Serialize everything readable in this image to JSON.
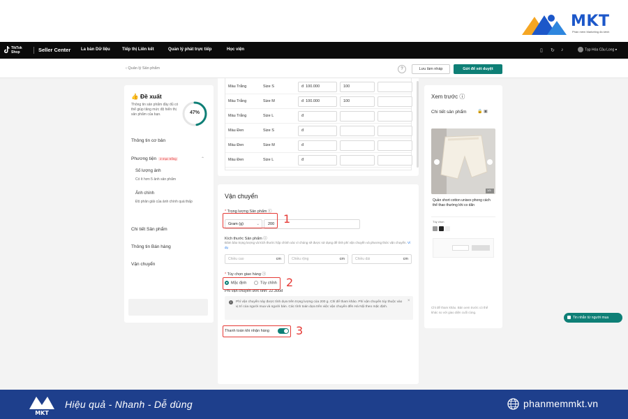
{
  "brand": {
    "name": "MKT",
    "subtitle": "Phần mềm Marketing đa kênh",
    "accent": "#1c57c9"
  },
  "topnav": {
    "logo_text": [
      "TikTok",
      "Shop"
    ],
    "title": "Seller Center",
    "links": [
      "La bàn Dữ liệu",
      "Tiếp thị Liên kết",
      "Quản lý phát trực tiếp",
      "Học viện"
    ],
    "user_name": "Tạp Hóa Cầu Long"
  },
  "subbar": {
    "breadcrumb": "‹ Quản lý Sản phẩm",
    "help_icon": "?",
    "save_draft": "Lưu làm nháp",
    "submit": "Gửi để xét duyệt",
    "accent": "#0e7f76"
  },
  "left_panel": {
    "title": "Đề xuất",
    "description": "Thông tin sản phẩm đầy đủ có thể giúp tăng mức độ hiển thị sản phẩm của bạn.",
    "progress_label": "47%",
    "progress_value": 47,
    "items": {
      "basic": "Thông tin cơ bản",
      "media": "Phương tiện",
      "media_badge": "2 mục trống",
      "image_count": "Số lượng ảnh",
      "image_count_desc": "Có ít hơn 5 ảnh sản phẩm",
      "main_image": "Ảnh chính",
      "main_image_desc": "Độ phân giải của ảnh chính quá thấp",
      "details": "Chi tiết Sản phẩm",
      "sales": "Thông tin Bán hàng",
      "shipping": "Vận chuyển"
    }
  },
  "variants": {
    "rows": [
      {
        "color": "Màu Trắng",
        "size": "Size S",
        "price": "100.000",
        "qty": "100"
      },
      {
        "color": "Màu Trắng",
        "size": "Size M",
        "price": "100.000",
        "qty": "100"
      },
      {
        "color": "Màu Trắng",
        "size": "Size L",
        "price": "",
        "qty": ""
      },
      {
        "color": "Màu Đen",
        "size": "Size S",
        "price": "",
        "qty": ""
      },
      {
        "color": "Màu Đen",
        "size": "Size M",
        "price": "",
        "qty": ""
      },
      {
        "color": "Màu Đen",
        "size": "Size L",
        "price": "",
        "qty": ""
      }
    ],
    "currency": "đ"
  },
  "shipping": {
    "title": "Vận chuyển",
    "weight_label": "Trọng lượng Sản phẩm",
    "weight_unit": "Gram (g)",
    "weight_value": "200",
    "dims_label": "Kích thước Sản phẩm",
    "dims_desc": "Đảm bảo trọng lượng và kích thước hộp chính xác vì chúng sẽ được sử dụng để tính phí vận chuyển và phương thức vận chuyển.",
    "dims_link": "Ví dụ",
    "dims": [
      {
        "placeholder": "Chiều cao",
        "unit": "cm"
      },
      {
        "placeholder": "Chiều rộng",
        "unit": "cm"
      },
      {
        "placeholder": "Chiều dài",
        "unit": "cm"
      }
    ],
    "options_label": "Tùy chọn giao hàng",
    "option_default": "Mặc định",
    "option_custom": "Tùy chỉnh",
    "fee": "Phí vận chuyển ước tính: 22.300đ",
    "info": "Phí vận chuyển này được tính dựa trên trọng lượng của 200 g. Chỉ để tham khảo. Phí vận chuyển tùy thuộc vào vị trí của người mua và người bán. Các tính toán dựa trên việc vận chuyển đến Hà Nội theo mặc định.",
    "cod_label": "Thanh toán khi nhận hàng",
    "cod_on": true
  },
  "annotations": [
    "1",
    "2",
    "3"
  ],
  "preview": {
    "title": "Xem trước",
    "subtitle": "Chi tiết sản phẩm",
    "image_counter": "1/5",
    "product_title": "Quần short cotton unisex phong cách thể thao thường khi co dãn",
    "option_label": "Tùy chọn",
    "caption": "Chỉ để tham khảo. Bản xem trước có thể khác so với giao diện cuối cùng."
  },
  "chat": {
    "label": "Tin nhắn từ người mua"
  },
  "footer": {
    "tagline": "Hiệu quả - Nhanh - Dễ dùng",
    "website": "phanmemmkt.vn",
    "bg": "#1e3f8c"
  }
}
